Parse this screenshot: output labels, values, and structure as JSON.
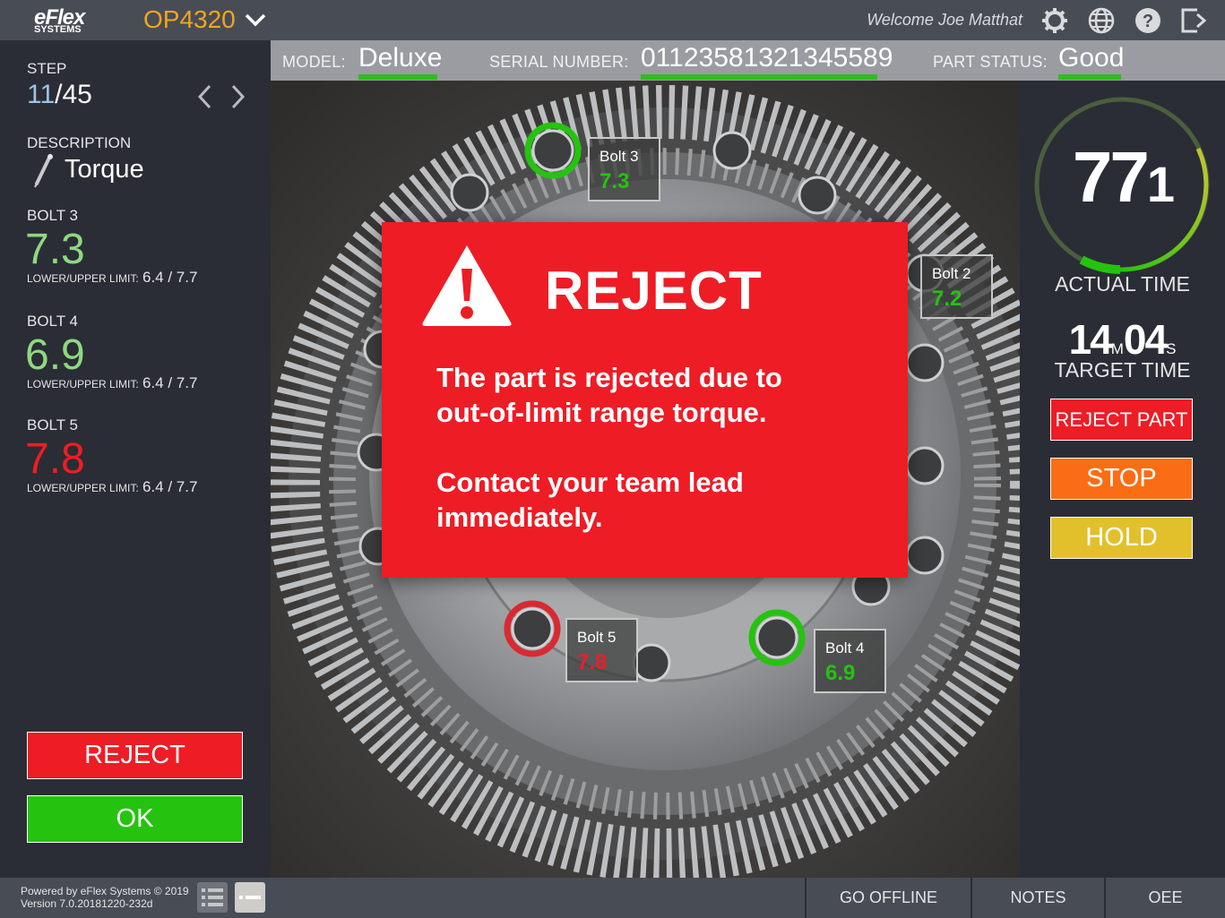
{
  "header": {
    "logo_line1": "eFlex",
    "logo_line2": "SYSTEMS",
    "operation": "OP4320",
    "welcome": "Welcome Joe Matthat",
    "icons": [
      "settings-icon",
      "globe-icon",
      "help-icon",
      "logout-icon"
    ]
  },
  "infobar": {
    "model_label": "MODEL:",
    "model_value": "Deluxe",
    "serial_label": "SERIAL NUMBER:",
    "serial_value": "01123581321345589",
    "status_label": "PART STATUS:",
    "status_value": "Good"
  },
  "left": {
    "step_label": "STEP",
    "step_current": "11",
    "step_total": "/45",
    "description_label": "DESCRIPTION",
    "description_value": "Torque",
    "bolts": [
      {
        "label": "BOLT 3",
        "value": "7.3",
        "limit_label": "LOWER/UPPER LIMIT:",
        "limit": "6.4 / 7.7",
        "status": "ok"
      },
      {
        "label": "BOLT 4",
        "value": "6.9",
        "limit_label": "LOWER/UPPER LIMIT:",
        "limit": "6.4 / 7.7",
        "status": "ok"
      },
      {
        "label": "BOLT 5",
        "value": "7.8",
        "limit_label": "LOWER/UPPER LIMIT:",
        "limit": "6.4 / 7.7",
        "status": "fail"
      }
    ],
    "reject_label": "REJECT",
    "ok_label": "OK"
  },
  "image_tags": [
    {
      "name": "Bolt 3",
      "value": "7.3",
      "status": "ok"
    },
    {
      "name": "Bolt 2",
      "value": "7.2",
      "status": "ok"
    },
    {
      "name": "Bolt 5",
      "value": "7.8",
      "status": "fail"
    },
    {
      "name": "Bolt 4",
      "value": "6.9",
      "status": "ok"
    }
  ],
  "modal": {
    "title": "REJECT",
    "line1": "The part is rejected due to",
    "line2": "out-of-limit range torque.",
    "line3": "Contact your team lead",
    "line4": "immediately."
  },
  "right": {
    "actual_time_big": "77",
    "actual_time_small": "1",
    "actual_label": "ACTUAL TIME",
    "target_minutes": "14",
    "target_min_unit": "M",
    "target_seconds": "04",
    "target_sec_unit": "S",
    "target_label": "TARGET TIME",
    "reject_part_label": "REJECT PART",
    "stop_label": "STOP",
    "hold_label": "HOLD"
  },
  "footer": {
    "powered_line1": "Powered by eFlex Systems © 2019",
    "powered_line2": "Version 7.0.20181220-232d",
    "go_offline": "GO OFFLINE",
    "notes": "NOTES",
    "oee": "OEE"
  },
  "colors": {
    "accent_orange": "#f0a61c",
    "ok_green": "#25c30f",
    "reject_red": "#ee1c25",
    "stop_orange": "#fb6d14",
    "hold_yellow": "#e2c02c"
  }
}
